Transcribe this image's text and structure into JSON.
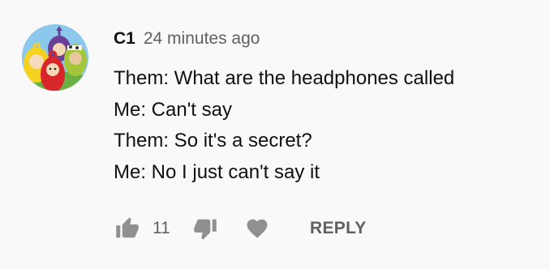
{
  "comment": {
    "author": "C1",
    "timestamp": "24 minutes ago",
    "lines": [
      "Them: What are the headphones called",
      "Me: Can't say",
      "Them: So it's a secret?",
      "Me: No I just can't say it"
    ]
  },
  "actions": {
    "like_icon": "thumbs-up-icon",
    "like_count": "11",
    "dislike_icon": "thumbs-down-icon",
    "heart_icon": "heart-icon",
    "reply_label": "REPLY"
  },
  "colors": {
    "background": "#f9f9f9",
    "text": "#111111",
    "secondary_text": "#606060",
    "icon": "#909090"
  }
}
